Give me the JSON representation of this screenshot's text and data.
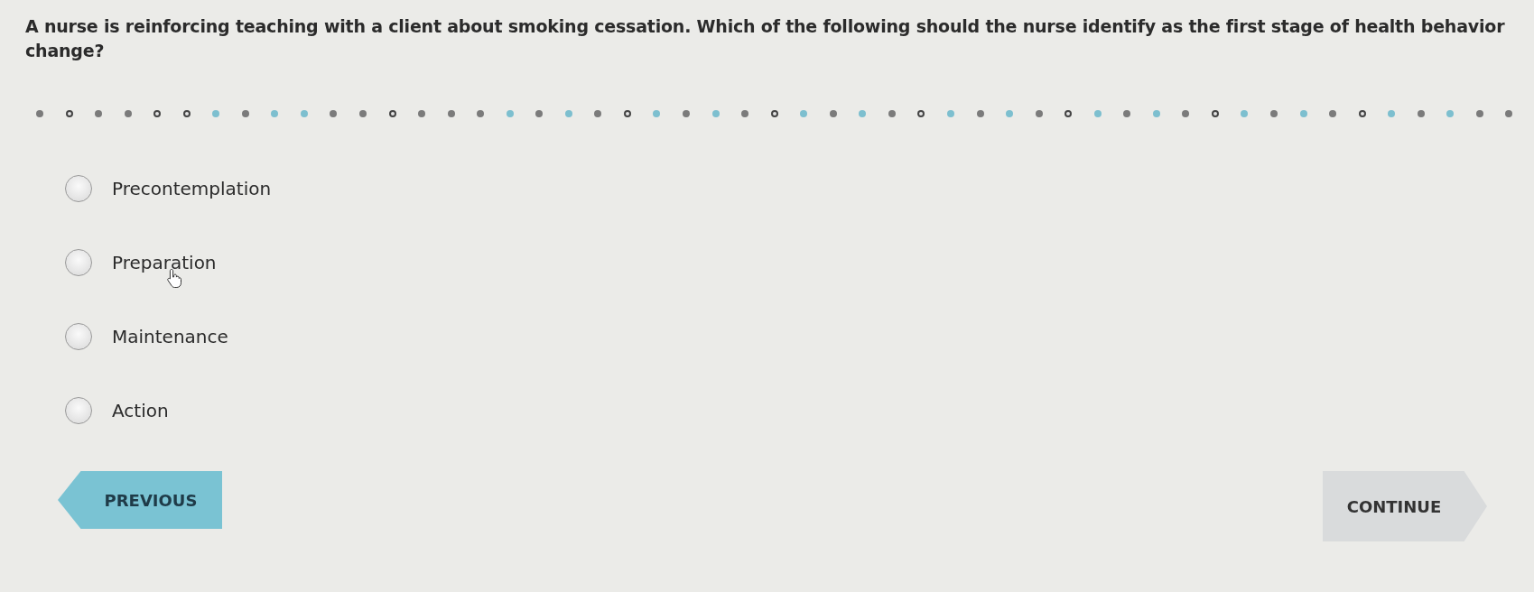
{
  "question": "A nurse is reinforcing teaching with a client about smoking cessation. Which of the following should the nurse identify as the first stage of health behavior change?",
  "progress": [
    {
      "kind": "solid"
    },
    {
      "kind": "ring"
    },
    {
      "kind": "solid"
    },
    {
      "kind": "solid"
    },
    {
      "kind": "ring"
    },
    {
      "kind": "ring"
    },
    {
      "kind": "accent"
    },
    {
      "kind": "solid"
    },
    {
      "kind": "accent"
    },
    {
      "kind": "accent"
    },
    {
      "kind": "solid"
    },
    {
      "kind": "solid"
    },
    {
      "kind": "ring"
    },
    {
      "kind": "solid"
    },
    {
      "kind": "solid"
    },
    {
      "kind": "solid"
    },
    {
      "kind": "accent"
    },
    {
      "kind": "solid"
    },
    {
      "kind": "accent"
    },
    {
      "kind": "solid"
    },
    {
      "kind": "ring"
    },
    {
      "kind": "accent"
    },
    {
      "kind": "solid"
    },
    {
      "kind": "accent"
    },
    {
      "kind": "solid"
    },
    {
      "kind": "ring"
    },
    {
      "kind": "accent"
    },
    {
      "kind": "solid"
    },
    {
      "kind": "accent"
    },
    {
      "kind": "solid"
    },
    {
      "kind": "ring"
    },
    {
      "kind": "accent"
    },
    {
      "kind": "solid"
    },
    {
      "kind": "accent"
    },
    {
      "kind": "solid"
    },
    {
      "kind": "ring"
    },
    {
      "kind": "accent"
    },
    {
      "kind": "solid"
    },
    {
      "kind": "accent"
    },
    {
      "kind": "solid"
    },
    {
      "kind": "ring"
    },
    {
      "kind": "accent"
    },
    {
      "kind": "solid"
    },
    {
      "kind": "accent"
    },
    {
      "kind": "solid"
    },
    {
      "kind": "ring"
    },
    {
      "kind": "accent"
    },
    {
      "kind": "solid"
    },
    {
      "kind": "accent"
    },
    {
      "kind": "solid"
    },
    {
      "kind": "solid"
    }
  ],
  "options": [
    {
      "label": "Precontemplation",
      "selected": false
    },
    {
      "label": "Preparation",
      "selected": false,
      "cursor": true
    },
    {
      "label": "Maintenance",
      "selected": false
    },
    {
      "label": "Action",
      "selected": false
    }
  ],
  "buttons": [
    {
      "label": "PREVIOUS",
      "kind": "back"
    },
    {
      "label": "CONTINUE",
      "kind": "next"
    }
  ]
}
